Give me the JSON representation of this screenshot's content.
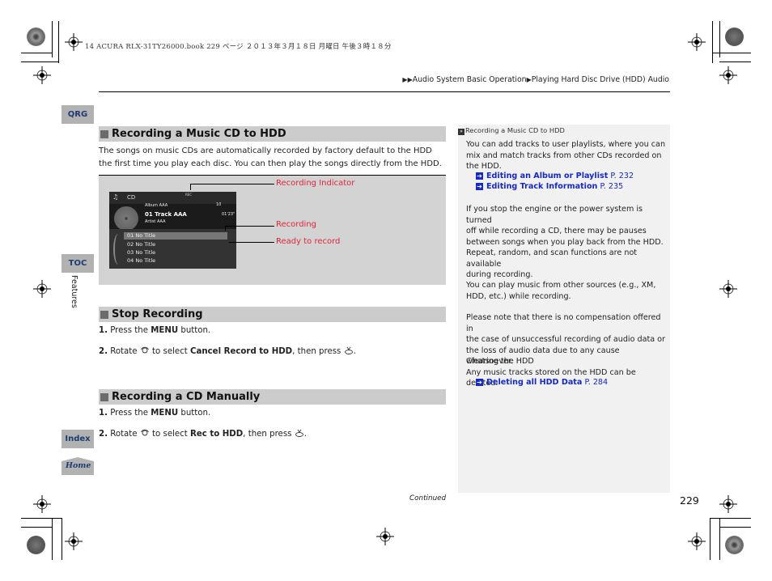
{
  "print_header": "14 ACURA RLX-31TY26000.book  229 ページ  ２０１３年３月１８日  月曜日  午後３時１８分",
  "breadcrumb": {
    "items": [
      "Audio System Basic Operation",
      "Playing Hard Disc Drive (HDD) Audio"
    ]
  },
  "side_tabs": {
    "qrg": "QRG",
    "toc": "TOC",
    "index": "Index",
    "home": "Home",
    "section_label": "Features"
  },
  "section1": {
    "title": "Recording a Music CD to HDD",
    "body_lines": [
      "The songs on music CDs are automatically recorded by factory default to the HDD",
      "the first time you play each disc. You can then play the songs directly from the HDD."
    ]
  },
  "figure": {
    "screen": {
      "source_label": "CD",
      "rec_label": "REC",
      "album": "Album AAA",
      "track": "01 Track AAA",
      "artist": "Artist AAA",
      "time": "01'23\"",
      "track_number": "10",
      "list": [
        "01 No Title",
        "02 No Title",
        "03 No Title",
        "04 No Title"
      ]
    },
    "callouts": {
      "recording_indicator": "Recording Indicator",
      "recording": "Recording",
      "ready_to_record": "Ready to record"
    },
    "callout_color": "#e0263a"
  },
  "section2": {
    "title": "Stop Recording",
    "step1": {
      "num": "1.",
      "pre": " Press the ",
      "bold": "MENU",
      "post": " button."
    },
    "step2": {
      "num": "2.",
      "pre": " Rotate ",
      "mid": " to select ",
      "bold": "Cancel Record to HDD",
      "post": ", then press ",
      "end": "."
    }
  },
  "section3": {
    "title": "Recording a CD Manually",
    "step1": {
      "num": "1.",
      "pre": " Press the ",
      "bold": "MENU",
      "post": " button."
    },
    "step2": {
      "num": "2.",
      "pre": " Rotate ",
      "mid": " to select ",
      "bold": "Rec to HDD",
      "post": ", then press ",
      "end": "."
    }
  },
  "side_panel": {
    "title": "Recording a Music CD to HDD",
    "p1": [
      "You can add tracks to user playlists, where you can",
      "mix and match tracks from other CDs recorded on",
      "the HDD."
    ],
    "links1": [
      {
        "label": "Editing an Album or Playlist",
        "page": "P. 232"
      },
      {
        "label": "Editing Track Information",
        "page": "P. 235"
      }
    ],
    "p2": [
      "If you stop the engine or the power system is turned",
      "off while recording a CD, there may be pauses",
      "between songs when you play back from the HDD."
    ],
    "p3": [
      "Repeat, random, and scan functions are not available",
      "during recording."
    ],
    "p4": [
      "You can play music from other sources (e.g., XM,",
      "HDD, etc.) while recording."
    ],
    "p5": [
      "Please note that there is no compensation offered in",
      "the case of unsuccessful recording of audio data or",
      "the loss of audio data due to any cause whatsoever."
    ],
    "p6": [
      "Clearing the HDD",
      "Any music tracks stored on the HDD can be deleted."
    ],
    "links2": [
      {
        "label": "Deleting all HDD Data",
        "page": "P. 284"
      }
    ],
    "link_color": "#1528c8"
  },
  "footer": {
    "continued": "Continued",
    "page_number": "229"
  }
}
